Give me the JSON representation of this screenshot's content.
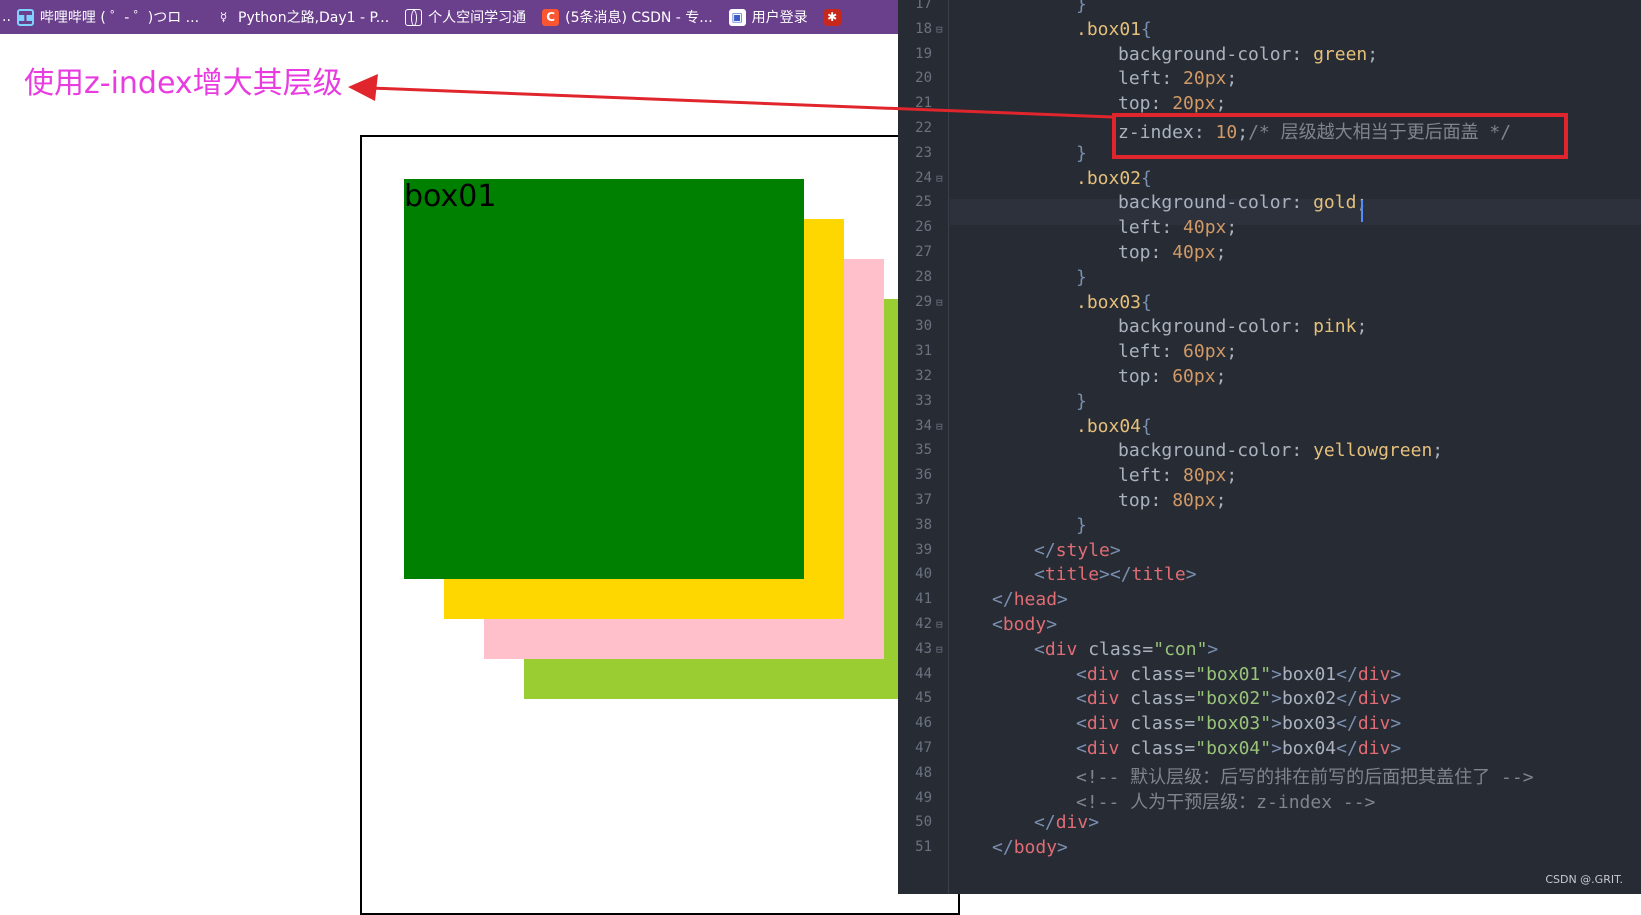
{
  "browser": {
    "bookmarks": [
      {
        "icon": "bilibili-icon",
        "label": "哔哩哔哩 ( ゜- ゜)つロ ..."
      },
      {
        "icon": "python-icon",
        "label": "Python之路,Day1 - P..."
      },
      {
        "icon": "globe-icon",
        "label": "个人空间学习通"
      },
      {
        "icon": "csdn-icon",
        "label": "(5条消息) CSDN - 专..."
      },
      {
        "icon": "login-icon",
        "label": "用户登录"
      }
    ]
  },
  "annotation": {
    "text": "使用z-index增大其层级",
    "color": "#e83ce0"
  },
  "demo": {
    "boxes": [
      {
        "label": "box01",
        "color": "#008000"
      },
      {
        "label": "",
        "color": "#ffd700"
      },
      {
        "label": "",
        "color": "#ffc0cb"
      },
      {
        "label": "",
        "color": "#9acd32"
      }
    ]
  },
  "editor": {
    "lines": [
      {
        "n": "17",
        "fold": "",
        "html": "<span class='br'>}</span>",
        "indent": 3
      },
      {
        "n": "18",
        "fold": "⊟",
        "html": "<span class='sel'>.box01</span><span class='br'>{</span>",
        "indent": 3
      },
      {
        "n": "19",
        "fold": "",
        "html": "<span class='prop'>background-color</span>: <span class='val'>green</span>;",
        "indent": 4
      },
      {
        "n": "20",
        "fold": "",
        "html": "<span class='prop'>left</span>: <span class='num'>20px</span>;",
        "indent": 4
      },
      {
        "n": "21",
        "fold": "",
        "html": "<span class='prop'>top</span>: <span class='num'>20px</span>;",
        "indent": 4
      },
      {
        "n": "22",
        "fold": "",
        "html": "<span class='prop'>z-index</span>: <span class='num'>10</span>;<span class='cmt'>/* 层级越大相当于更后面盖 */</span>",
        "indent": 4
      },
      {
        "n": "23",
        "fold": "",
        "html": "<span class='br'>}</span>",
        "indent": 3
      },
      {
        "n": "24",
        "fold": "⊟",
        "html": "<span class='sel'>.box02</span><span class='br'>{</span>",
        "indent": 3
      },
      {
        "n": "25",
        "fold": "",
        "html": "<span class='prop'>background-color</span>: <span class='val'>gold</span>;",
        "indent": 4
      },
      {
        "n": "26",
        "fold": "",
        "html": "<span class='prop'>left</span>: <span class='num'>40px</span>;",
        "indent": 4
      },
      {
        "n": "27",
        "fold": "",
        "html": "<span class='prop'>top</span>: <span class='num'>40px</span>;",
        "indent": 4
      },
      {
        "n": "28",
        "fold": "",
        "html": "<span class='br'>}</span>",
        "indent": 3
      },
      {
        "n": "29",
        "fold": "⊟",
        "html": "<span class='sel'>.box03</span><span class='br'>{</span>",
        "indent": 3
      },
      {
        "n": "30",
        "fold": "",
        "html": "<span class='prop'>background-color</span>: <span class='val'>pink</span>;",
        "indent": 4
      },
      {
        "n": "31",
        "fold": "",
        "html": "<span class='prop'>left</span>: <span class='num'>60px</span>;",
        "indent": 4
      },
      {
        "n": "32",
        "fold": "",
        "html": "<span class='prop'>top</span>: <span class='num'>60px</span>;",
        "indent": 4
      },
      {
        "n": "33",
        "fold": "",
        "html": "<span class='br'>}</span>",
        "indent": 3
      },
      {
        "n": "34",
        "fold": "⊟",
        "html": "<span class='sel'>.box04</span><span class='br'>{</span>",
        "indent": 3
      },
      {
        "n": "35",
        "fold": "",
        "html": "<span class='prop'>background-color</span>: <span class='val'>yellowgreen</span>;",
        "indent": 4
      },
      {
        "n": "36",
        "fold": "",
        "html": "<span class='prop'>left</span>: <span class='num'>80px</span>;",
        "indent": 4
      },
      {
        "n": "37",
        "fold": "",
        "html": "<span class='prop'>top</span>: <span class='num'>80px</span>;",
        "indent": 4
      },
      {
        "n": "38",
        "fold": "",
        "html": "<span class='br'>}</span>",
        "indent": 3
      },
      {
        "n": "39",
        "fold": "",
        "html": "<span class='br'>&lt;/</span><span class='tag'>style</span><span class='br'>&gt;</span>",
        "indent": 2
      },
      {
        "n": "40",
        "fold": "",
        "html": "<span class='br'>&lt;</span><span class='tag'>title</span><span class='br'>&gt;&lt;/</span><span class='tag'>title</span><span class='br'>&gt;</span>",
        "indent": 2
      },
      {
        "n": "41",
        "fold": "",
        "html": "<span class='br'>&lt;/</span><span class='tag'>head</span><span class='br'>&gt;</span>",
        "indent": 1
      },
      {
        "n": "42",
        "fold": "⊟",
        "html": "<span class='br'>&lt;</span><span class='tag'>body</span><span class='br'>&gt;</span>",
        "indent": 1
      },
      {
        "n": "43",
        "fold": "⊟",
        "html": "<span class='br'>&lt;</span><span class='tag'>div</span> <span class='attr'>class</span>=<span class='str'>\"con\"</span><span class='br'>&gt;</span>",
        "indent": 2
      },
      {
        "n": "44",
        "fold": "",
        "html": "<span class='br'>&lt;</span><span class='tag'>div</span> <span class='attr'>class</span>=<span class='str'>\"box01\"</span><span class='br'>&gt;</span>box01<span class='br'>&lt;/</span><span class='tag'>div</span><span class='br'>&gt;</span>",
        "indent": 3
      },
      {
        "n": "45",
        "fold": "",
        "html": "<span class='br'>&lt;</span><span class='tag'>div</span> <span class='attr'>class</span>=<span class='str'>\"box02\"</span><span class='br'>&gt;</span>box02<span class='br'>&lt;/</span><span class='tag'>div</span><span class='br'>&gt;</span>",
        "indent": 3
      },
      {
        "n": "46",
        "fold": "",
        "html": "<span class='br'>&lt;</span><span class='tag'>div</span> <span class='attr'>class</span>=<span class='str'>\"box03\"</span><span class='br'>&gt;</span>box03<span class='br'>&lt;/</span><span class='tag'>div</span><span class='br'>&gt;</span>",
        "indent": 3
      },
      {
        "n": "47",
        "fold": "",
        "html": "<span class='br'>&lt;</span><span class='tag'>div</span> <span class='attr'>class</span>=<span class='str'>\"box04\"</span><span class='br'>&gt;</span>box04<span class='br'>&lt;/</span><span class='tag'>div</span><span class='br'>&gt;</span>",
        "indent": 3
      },
      {
        "n": "48",
        "fold": "",
        "html": "<span class='cmt'>&lt;!-- 默认层级：后写的排在前写的后面把其盖住了 --&gt;</span>",
        "indent": 3
      },
      {
        "n": "49",
        "fold": "",
        "html": "<span class='cmt'>&lt;!-- 人为干预层级：z-index --&gt;</span>",
        "indent": 3
      },
      {
        "n": "50",
        "fold": "",
        "html": "<span class='br'>&lt;/</span><span class='tag'>div</span><span class='br'>&gt;</span>",
        "indent": 2
      },
      {
        "n": "51",
        "fold": "",
        "html": "<span class='br'>&lt;/</span><span class='tag'>body</span><span class='br'>&gt;</span>",
        "indent": 1
      }
    ]
  },
  "watermark": "CSDN @.GRIT."
}
